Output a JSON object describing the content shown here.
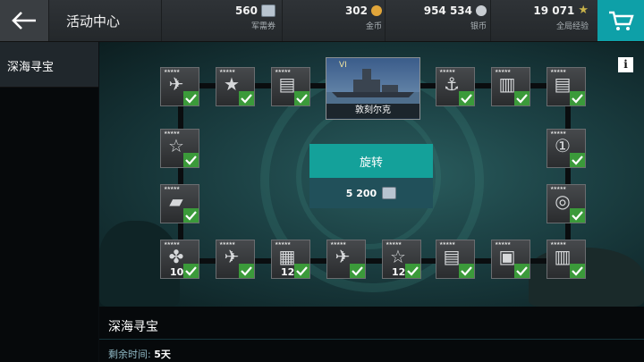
{
  "header": {
    "title": "活动中心",
    "currencies": [
      {
        "value": "560",
        "label": "军需券",
        "icon": "voucher-icon",
        "color": "#b8c4d0"
      },
      {
        "value": "302",
        "label": "金币",
        "icon": "gold-coin-icon",
        "color": "#e0a53a"
      },
      {
        "value": "954 534",
        "label": "银币",
        "icon": "silver-coin-icon",
        "color": "#c8cdd2"
      },
      {
        "value": "19 071",
        "label": "全局经验",
        "icon": "star-exp-icon",
        "color": "#c9b34a"
      }
    ],
    "cart_icon": "cart-icon"
  },
  "sidebar": {
    "items": [
      {
        "label": "深海寻宝",
        "selected": true
      }
    ]
  },
  "board": {
    "grand_prize": {
      "tier": "VI",
      "name": "敦刻尔克"
    },
    "spin_label": "旋转",
    "spin_cost": "5 200",
    "info_label": "i",
    "tiles": [
      {
        "id": "t1",
        "icon": "aircraft-icon",
        "claimed": true,
        "count": ""
      },
      {
        "id": "t2",
        "icon": "rank-badge-icon",
        "claimed": true,
        "count": ""
      },
      {
        "id": "t3",
        "icon": "gun-module-icon",
        "claimed": true,
        "count": ""
      },
      {
        "id": "t4",
        "icon": "ship-crew-icon",
        "claimed": true,
        "count": ""
      },
      {
        "id": "t5",
        "icon": "turret-icon",
        "claimed": true,
        "count": ""
      },
      {
        "id": "t6",
        "icon": "gun-module-icon",
        "claimed": true,
        "count": ""
      },
      {
        "id": "t7",
        "icon": "star-rank-icon",
        "claimed": true,
        "count": ""
      },
      {
        "id": "t8",
        "icon": "medal-one-icon",
        "claimed": true,
        "count": ""
      },
      {
        "id": "t9",
        "icon": "torpedo-icon",
        "claimed": true,
        "count": ""
      },
      {
        "id": "t10",
        "icon": "coin-stack-icon",
        "claimed": true,
        "count": ""
      },
      {
        "id": "t11",
        "icon": "propeller-icon",
        "claimed": true,
        "count": "10"
      },
      {
        "id": "t12",
        "icon": "aircraft-icon",
        "claimed": true,
        "count": ""
      },
      {
        "id": "t13",
        "icon": "supplies-icon",
        "claimed": true,
        "count": "12"
      },
      {
        "id": "t14",
        "icon": "aircraft-icon",
        "claimed": true,
        "count": ""
      },
      {
        "id": "t15",
        "icon": "star-rank-icon",
        "claimed": true,
        "count": "12"
      },
      {
        "id": "t16",
        "icon": "gun-module-icon",
        "claimed": true,
        "count": ""
      },
      {
        "id": "t17",
        "icon": "radar-icon",
        "claimed": true,
        "count": ""
      },
      {
        "id": "t18",
        "icon": "turret-icon",
        "claimed": true,
        "count": ""
      }
    ]
  },
  "footer": {
    "title": "深海寻宝",
    "remaining_label": "剩余时间:",
    "remaining_value": "5天"
  }
}
